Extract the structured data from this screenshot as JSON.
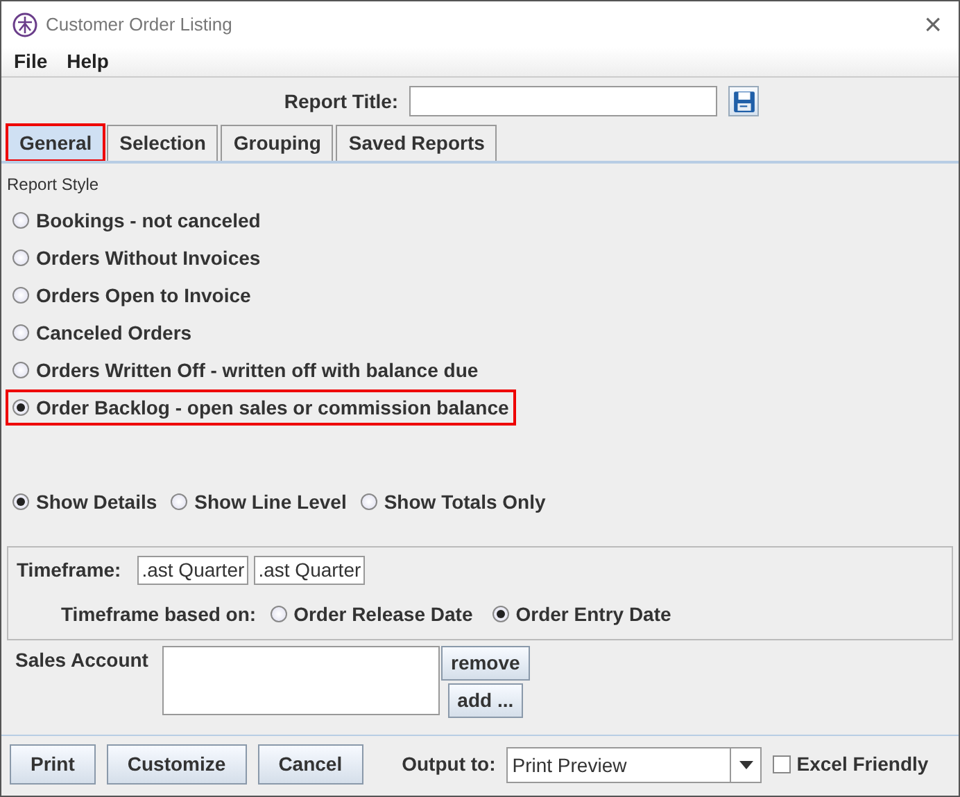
{
  "window": {
    "title": "Customer Order Listing",
    "close": "×"
  },
  "menu": [
    "File",
    "Help"
  ],
  "report_title": {
    "label": "Report Title:"
  },
  "tabs": [
    {
      "label": "General",
      "selected": true,
      "highlighted": true
    },
    {
      "label": "Selection",
      "selected": false,
      "highlighted": false
    },
    {
      "label": "Grouping",
      "selected": false,
      "highlighted": false
    },
    {
      "label": "Saved Reports",
      "selected": false,
      "highlighted": false
    }
  ],
  "report_style": {
    "label": "Report Style",
    "options": [
      {
        "label": "Bookings - not canceled",
        "selected": false,
        "highlighted": false
      },
      {
        "label": "Orders  Without Invoices",
        "selected": false,
        "highlighted": false
      },
      {
        "label": "Orders Open to Invoice",
        "selected": false,
        "highlighted": false
      },
      {
        "label": "Canceled Orders",
        "selected": false,
        "highlighted": false
      },
      {
        "label": "Orders Written Off - written off with balance due",
        "selected": false,
        "highlighted": false
      },
      {
        "label": "Order Backlog - open sales or commission balance",
        "selected": true,
        "highlighted": true
      }
    ]
  },
  "detail_level": [
    {
      "label": "Show Details",
      "selected": true
    },
    {
      "label": "Show Line Level",
      "selected": false
    },
    {
      "label": "Show Totals Only",
      "selected": false
    }
  ],
  "timeframe": {
    "label": "Timeframe:",
    "from": ".ast Quarter",
    "to": ".ast Quarter",
    "based_on_label": "Timeframe based on:",
    "based_on": [
      {
        "label": "Order Release Date",
        "selected": false
      },
      {
        "label": "Order Entry Date",
        "selected": true
      }
    ]
  },
  "sales_account": {
    "label": "Sales Account",
    "buttons": [
      "remove",
      "add ..."
    ]
  },
  "footer": {
    "buttons": [
      "Print",
      "Customize",
      "Cancel"
    ],
    "output_label": "Output to:",
    "output_value": "Print Preview",
    "excel": {
      "label": "Excel Friendly",
      "checked": false
    }
  }
}
